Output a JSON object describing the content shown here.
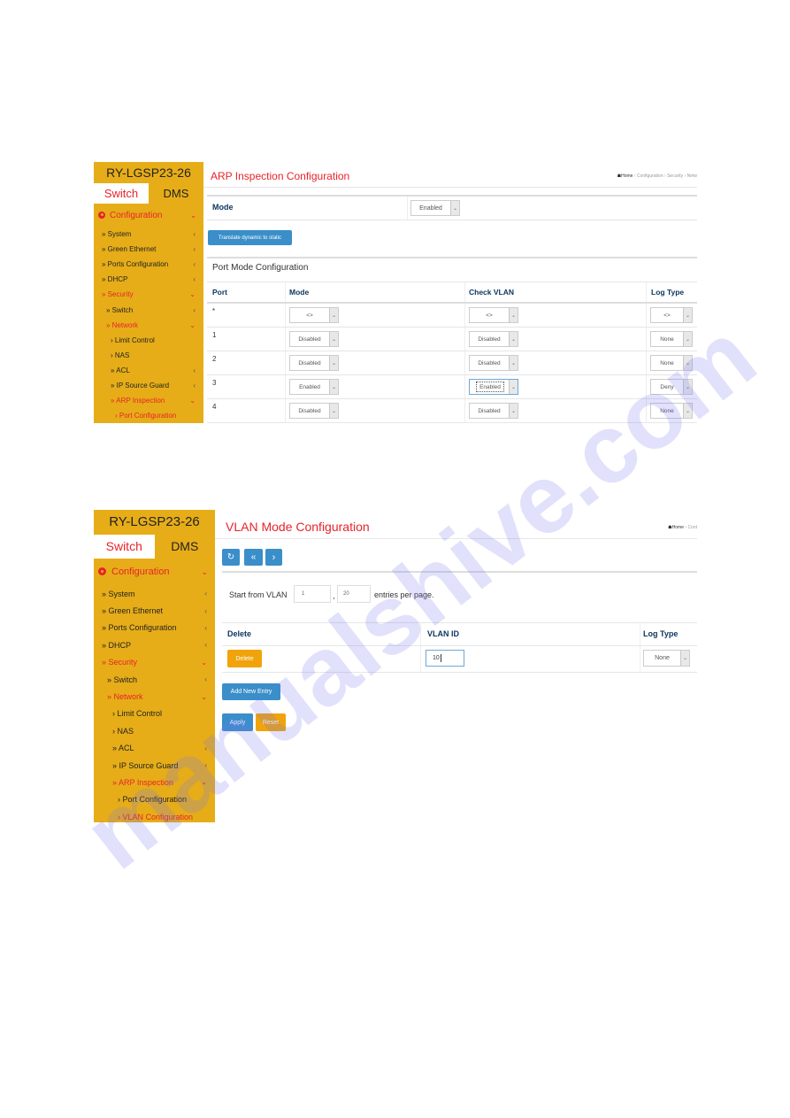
{
  "watermark": "manualshive.com",
  "colors": {
    "sidebar_bg": "#e6ad18",
    "accent_red": "#e8232a",
    "button_blue": "#3a8ec9",
    "button_orange": "#f0a30a",
    "header_navy": "#0f3660"
  },
  "panel1": {
    "sidebar": {
      "device_name": "RY-LGSP23-26",
      "tabs": [
        {
          "label": "Switch",
          "active": true
        },
        {
          "label": "DMS",
          "active": false
        }
      ],
      "configuration_label": "Configuration",
      "items": [
        {
          "label": "» System",
          "chevron": "‹",
          "active": false
        },
        {
          "label": "» Green Ethernet",
          "chevron": "‹",
          "active": false
        },
        {
          "label": "» Ports Configuration",
          "chevron": "‹",
          "active": false
        },
        {
          "label": "» DHCP",
          "chevron": "‹",
          "active": false
        },
        {
          "label": "» Security",
          "chevron": "⌄",
          "active": true
        },
        {
          "label": "» Switch",
          "chevron": "‹",
          "active": false
        },
        {
          "label": "» Network",
          "chevron": "⌄",
          "active": true
        },
        {
          "label": "› Limit Control",
          "chevron": "",
          "active": false
        },
        {
          "label": "› NAS",
          "chevron": "",
          "active": false
        },
        {
          "label": "» ACL",
          "chevron": "‹",
          "active": false
        },
        {
          "label": "» IP Source Guard",
          "chevron": "‹",
          "active": false
        },
        {
          "label": "» ARP Inspection",
          "chevron": "⌄",
          "active": true
        },
        {
          "label": "› Port Configuration",
          "chevron": "",
          "active": true
        }
      ]
    },
    "title": "ARP Inspection Configuration",
    "breadcrumb": {
      "home": "Home",
      "items": [
        "Configuration",
        "Security",
        "Netw"
      ]
    },
    "mode": {
      "label": "Mode",
      "value": "Enabled"
    },
    "translate_button": "Translate dynamic to static",
    "section_title": "Port Mode Configuration",
    "table": {
      "headers": [
        "Port",
        "Mode",
        "Check VLAN",
        "Log Type"
      ],
      "rows": [
        {
          "port": "*",
          "mode": "<>",
          "check_vlan": "<>",
          "log_type": "<>"
        },
        {
          "port": "1",
          "mode": "Disabled",
          "check_vlan": "Disabled",
          "log_type": "None"
        },
        {
          "port": "2",
          "mode": "Disabled",
          "check_vlan": "Disabled",
          "log_type": "None"
        },
        {
          "port": "3",
          "mode": "Enabled",
          "check_vlan": "Enabled",
          "log_type": "Deny"
        },
        {
          "port": "4",
          "mode": "Disabled",
          "check_vlan": "Disabled",
          "log_type": "None"
        }
      ]
    }
  },
  "panel2": {
    "sidebar": {
      "device_name": "RY-LGSP23-26",
      "tabs": [
        {
          "label": "Switch",
          "active": true
        },
        {
          "label": "DMS",
          "active": false
        }
      ],
      "configuration_label": "Configuration",
      "items": [
        {
          "label": "» System",
          "chevron": "‹",
          "active": false
        },
        {
          "label": "» Green Ethernet",
          "chevron": "‹",
          "active": false
        },
        {
          "label": "» Ports Configuration",
          "chevron": "‹",
          "active": false
        },
        {
          "label": "» DHCP",
          "chevron": "‹",
          "active": false
        },
        {
          "label": "» Security",
          "chevron": "⌄",
          "active": true
        },
        {
          "label": "» Switch",
          "chevron": "‹",
          "active": false
        },
        {
          "label": "» Network",
          "chevron": "⌄",
          "active": true
        },
        {
          "label": "› Limit Control",
          "chevron": "",
          "active": false
        },
        {
          "label": "› NAS",
          "chevron": "",
          "active": false
        },
        {
          "label": "» ACL",
          "chevron": "‹",
          "active": false
        },
        {
          "label": "» IP Source Guard",
          "chevron": "‹",
          "active": false
        },
        {
          "label": "» ARP Inspection",
          "chevron": "⌄",
          "active": true
        },
        {
          "label": "› Port Configuration",
          "chevron": "",
          "active": false
        },
        {
          "label": "› VLAN Configuration",
          "chevron": "",
          "active": true
        }
      ]
    },
    "title": "VLAN Mode Configuration",
    "breadcrumb": {
      "home": "Home",
      "items": [
        "Cont"
      ]
    },
    "toolbar": {
      "refresh_icon": "↻",
      "first_icon": "«",
      "next_icon": "›"
    },
    "paging": {
      "prefix": "Start from VLAN",
      "start_value": "1",
      "separator": ",",
      "per_page_value": "20",
      "suffix": "entries per page."
    },
    "table": {
      "headers": [
        "Delete",
        "VLAN ID",
        "Log Type"
      ],
      "rows": [
        {
          "delete_label": "Delete",
          "vlan_id": "10",
          "log_type": "None"
        }
      ]
    },
    "add_button": "Add New Entry",
    "apply_button": "Apply",
    "reset_button": "Reset"
  }
}
